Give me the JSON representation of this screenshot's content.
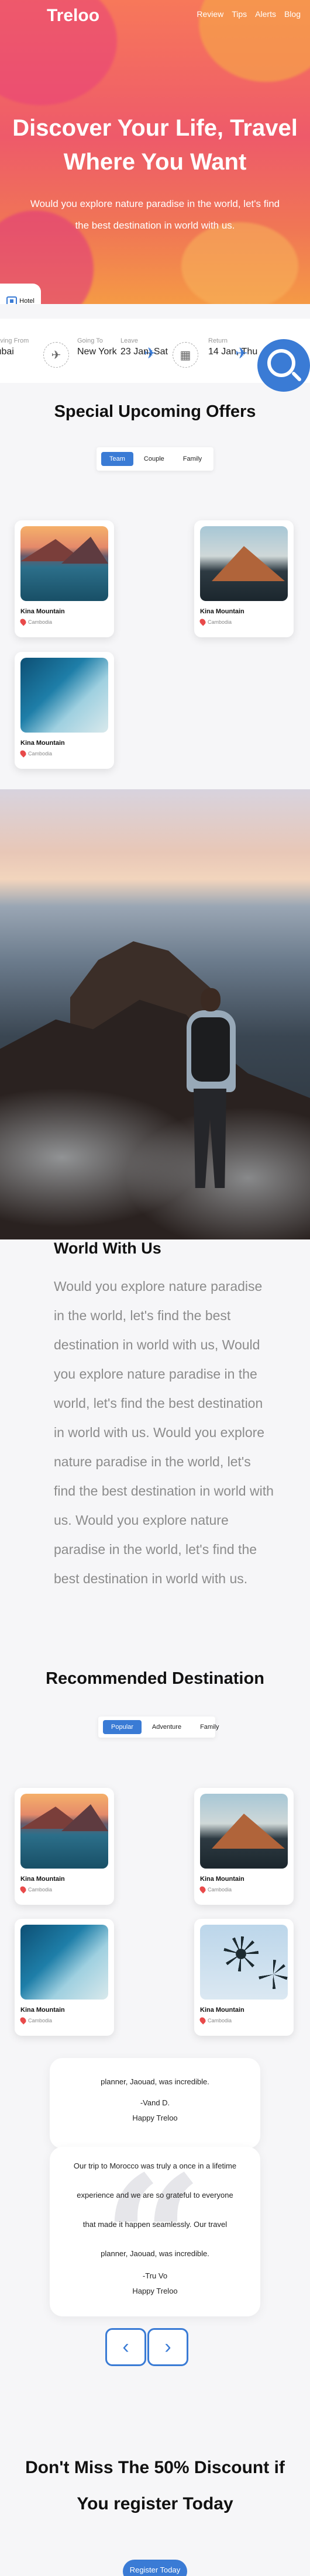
{
  "brand": {
    "logo": "Treloo"
  },
  "nav": [
    "Review",
    "Tips",
    "Alerts",
    "Blog"
  ],
  "hero": {
    "title_line1": "Discover Your Life, Travel",
    "title_line2": "Where You Want",
    "subtitle_line1": "Would you explore nature paradise in the world, let's find",
    "subtitle_line2": "the best destination in world with us."
  },
  "search": {
    "tab_label": "Hotel",
    "from_label": "Leaving From",
    "from_value": "Dubai",
    "to_label": "Going To",
    "to_value": "New York",
    "leave_label": "Leave",
    "leave_value": "23 Jan, Sat",
    "return_label": "Return",
    "return_value": "14 Jan, Thu"
  },
  "offers": {
    "title": "Special Upcoming Offers",
    "tabs": [
      "Team",
      "Couple",
      "Family"
    ],
    "active_tab": "Team",
    "cards": [
      {
        "name": "Kina Mountain",
        "location": "Cambodia",
        "image": "lake"
      },
      {
        "name": "Kina Mountain",
        "location": "Cambodia",
        "image": "mountain"
      },
      {
        "name": "Kina Mountain",
        "location": "Cambodia",
        "image": "shore"
      }
    ]
  },
  "world": {
    "title": "World With Us",
    "body": "Would you explore nature paradise in the world, let's find the best destination in world with us, Would you explore nature paradise in the world, let's find the best destination in world with us. Would you explore nature paradise in the world, let's find the best destination in world with us. Would you explore nature paradise in the world, let's find the best destination in world with us."
  },
  "recommended": {
    "title": "Recommended Destination",
    "tabs": [
      "Popular",
      "Adventure",
      "Family"
    ],
    "active_tab": "Popular",
    "cards": [
      {
        "name": "Kina Mountain",
        "location": "Cambodia",
        "image": "lake"
      },
      {
        "name": "Kina Mountain",
        "location": "Cambodia",
        "image": "mountain"
      },
      {
        "name": "Kina Mountain",
        "location": "Cambodia",
        "image": "shore"
      },
      {
        "name": "Kina Mountain",
        "location": "Cambodia",
        "image": "palm"
      }
    ]
  },
  "testimonials": [
    {
      "text_lines": [
        "planner, Jaouad, was incredible."
      ],
      "author": "-Vand D.",
      "caption": "Happy Treloo"
    },
    {
      "text_lines": [
        "Our trip to Morocco was truly a once in a lifetime",
        "experience and we are so grateful to everyone",
        "that made it happen seamlessly. Our travel",
        "planner, Jaouad, was incredible."
      ],
      "author": "-Tru Vo",
      "caption": "Happy Treloo"
    }
  ],
  "carousel": {
    "prev": "‹",
    "next": "›"
  },
  "cta": {
    "line1": "Don't Miss The 50% Discount if",
    "line2": "You register Today",
    "button": "Register Today"
  },
  "colors": {
    "accent": "#3a7bd5",
    "hero_start": "#f7785a",
    "hero_end": "#f59a45"
  }
}
